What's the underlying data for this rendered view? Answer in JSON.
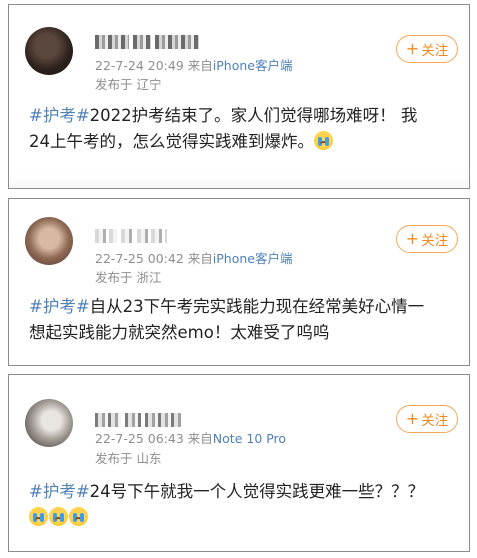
{
  "posts": [
    {
      "meta_time": "22-7-24 20:49",
      "meta_from": "来自",
      "meta_source": "iPhone客户端",
      "location_label": "发布于",
      "location": "辽宁",
      "follow_label": "关注",
      "hashtag": "#护考#",
      "text_line1": "2022护考结束了。家人们觉得哪场难呀！ 我",
      "text_line2": "24上午考的，怎么觉得实践难到爆炸。",
      "emoji_count": 1
    },
    {
      "meta_time": "22-7-25 00:42",
      "meta_from": "来自",
      "meta_source": "iPhone客户端",
      "location_label": "发布于",
      "location": "浙江",
      "follow_label": "关注",
      "hashtag": "#护考#",
      "text_line1": "自从23下午考完实践能力现在经常美好心情一",
      "text_line2": "想起实践能力就突然emo！太难受了呜呜",
      "emoji_count": 0
    },
    {
      "meta_time": "22-7-25 06:43",
      "meta_from": "来自",
      "meta_source": "Note 10 Pro",
      "location_label": "发布于",
      "location": "山东",
      "follow_label": "关注",
      "hashtag": "#护考#",
      "text_line1": "24号下午就我一个人觉得实践更难一些？？？",
      "text_line2": "",
      "emoji_count": 3
    }
  ],
  "colors": {
    "link_blue": "#4f80b6",
    "follow_orange": "#f08a24",
    "meta_gray": "#8e8e8e"
  }
}
